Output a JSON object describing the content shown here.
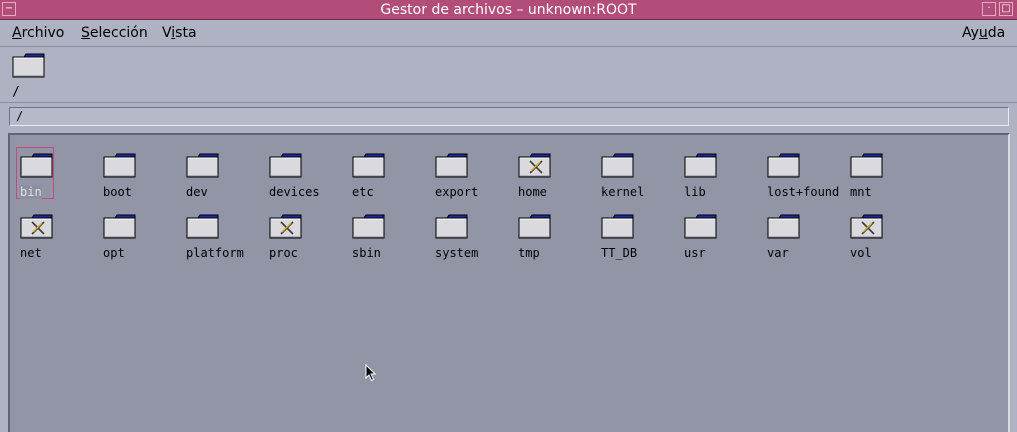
{
  "window": {
    "title": "Gestor de archivos – unknown:ROOT"
  },
  "menubar": {
    "archivo": {
      "u": "A",
      "rest": "rchivo"
    },
    "seleccion": {
      "u": "S",
      "rest": "elección"
    },
    "vista": {
      "pre": "V",
      "u": "i",
      "rest": "sta"
    },
    "ayuda": {
      "pre": "Ay",
      "u": "u",
      "rest": "da"
    }
  },
  "current_folder": {
    "label": "/"
  },
  "path_field": {
    "value": "/"
  },
  "folders": [
    {
      "name": "bin",
      "locked": false,
      "selected": true
    },
    {
      "name": "boot",
      "locked": false
    },
    {
      "name": "dev",
      "locked": false
    },
    {
      "name": "devices",
      "locked": false
    },
    {
      "name": "etc",
      "locked": false
    },
    {
      "name": "export",
      "locked": false
    },
    {
      "name": "home",
      "locked": true
    },
    {
      "name": "kernel",
      "locked": false
    },
    {
      "name": "lib",
      "locked": false
    },
    {
      "name": "lost+found",
      "locked": false
    },
    {
      "name": "mnt",
      "locked": false
    },
    {
      "name": "net",
      "locked": true
    },
    {
      "name": "opt",
      "locked": false
    },
    {
      "name": "platform",
      "locked": false
    },
    {
      "name": "proc",
      "locked": true
    },
    {
      "name": "sbin",
      "locked": false
    },
    {
      "name": "system",
      "locked": false
    },
    {
      "name": "tmp",
      "locked": false
    },
    {
      "name": "TT_DB",
      "locked": false
    },
    {
      "name": "usr",
      "locked": false
    },
    {
      "name": "var",
      "locked": false
    },
    {
      "name": "vol",
      "locked": true
    }
  ],
  "colors": {
    "titlebar": "#b24d7a",
    "background": "#aeb2c3",
    "pane": "#9195a6",
    "selection": "#c24a7f"
  }
}
